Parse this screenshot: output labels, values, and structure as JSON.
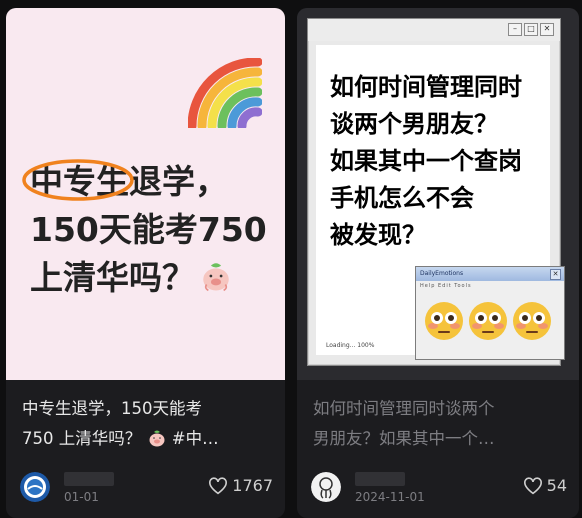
{
  "posts": [
    {
      "cover": {
        "title_lines": [
          "中专生退学，",
          "150天能考750",
          "上清华吗？"
        ],
        "highlight": "中专生",
        "title_rest_line1": "退学，",
        "decor": [
          "rainbow-icon",
          "pig-emoji-icon"
        ]
      },
      "caption_lines": [
        "中专生退学，150天能考",
        "750 上清华吗？",
        " #中…"
      ],
      "author": "",
      "date": "01-01",
      "likes": "1767"
    },
    {
      "cover": {
        "question_lines": [
          "如何时间管理同时",
          "谈两个男朋友？",
          "如果其中一个查岗",
          "手机怎么不会",
          "被发现？"
        ],
        "loading_text": "Loading... 100%",
        "popup_title": "DailyEmotions",
        "popup_menu": "Help  Edit  Tools",
        "faces": [
          "flushed-face-icon",
          "flushed-face-icon",
          "flushed-face-icon"
        ]
      },
      "caption_lines": [
        "如何时间管理同时谈两个",
        "男朋友？如果其中一个…"
      ],
      "author": "",
      "date": "2024-11-01",
      "likes": "54"
    }
  ],
  "colors": {
    "background": "#0f0f10",
    "card": "#1c1c1f",
    "left_cover_bg": "#f9e9f0",
    "highlight_circle": "#f0821e"
  }
}
